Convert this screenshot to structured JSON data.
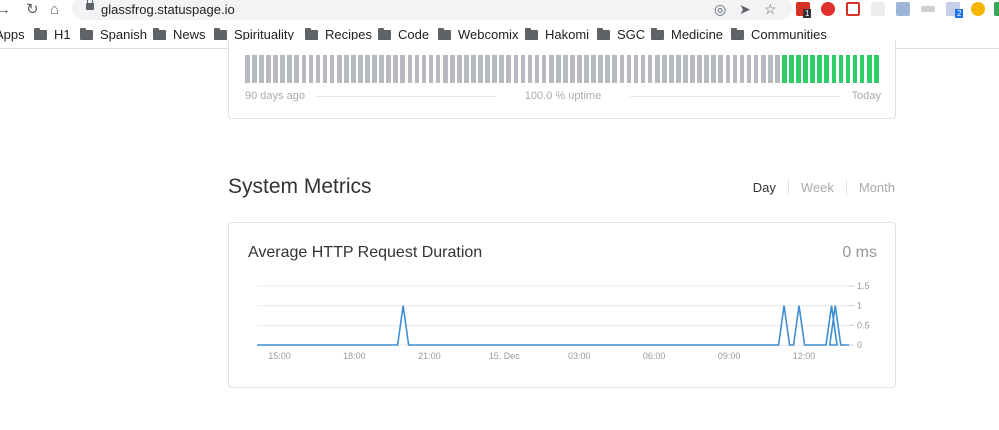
{
  "browser": {
    "url": "glassfrog.statuspage.io",
    "bookmarks": [
      "Apps",
      "H1",
      "Spanish",
      "News",
      "Spirituality",
      "Recipes",
      "Code",
      "Webcomix",
      "Hakomi",
      "SGC",
      "Medicine",
      "Communities"
    ],
    "extension_badges": [
      "1",
      "2"
    ]
  },
  "uptime": {
    "left_label": "90 days ago",
    "center_label": "100.0 % uptime",
    "right_label": "Today",
    "total_days": 90,
    "green_days": 14,
    "colors": {
      "no_data": "#b7bac0",
      "operational": "#2fcc66"
    }
  },
  "metrics": {
    "title": "System Metrics",
    "tabs": [
      "Day",
      "Week",
      "Month"
    ],
    "active_tab": "Day",
    "card": {
      "title": "Average HTTP Request Duration",
      "value": "0 ms"
    }
  },
  "chart_data": {
    "type": "line",
    "x_tick_labels": [
      "15:00",
      "18:00",
      "21:00",
      "15. Dec",
      "03:00",
      "06:00",
      "09:00",
      "12:00"
    ],
    "y_tick_labels": [
      "1.5",
      "1",
      "0.5",
      "0"
    ],
    "ylim": [
      0,
      1.5
    ],
    "x_range_hours": [
      14.1,
      37.8
    ],
    "spikes_hours": [
      19.95,
      35.2,
      35.8,
      37.1,
      37.25
    ],
    "spike_value": 1,
    "grid": true,
    "line_color": "#3f8fd2"
  }
}
